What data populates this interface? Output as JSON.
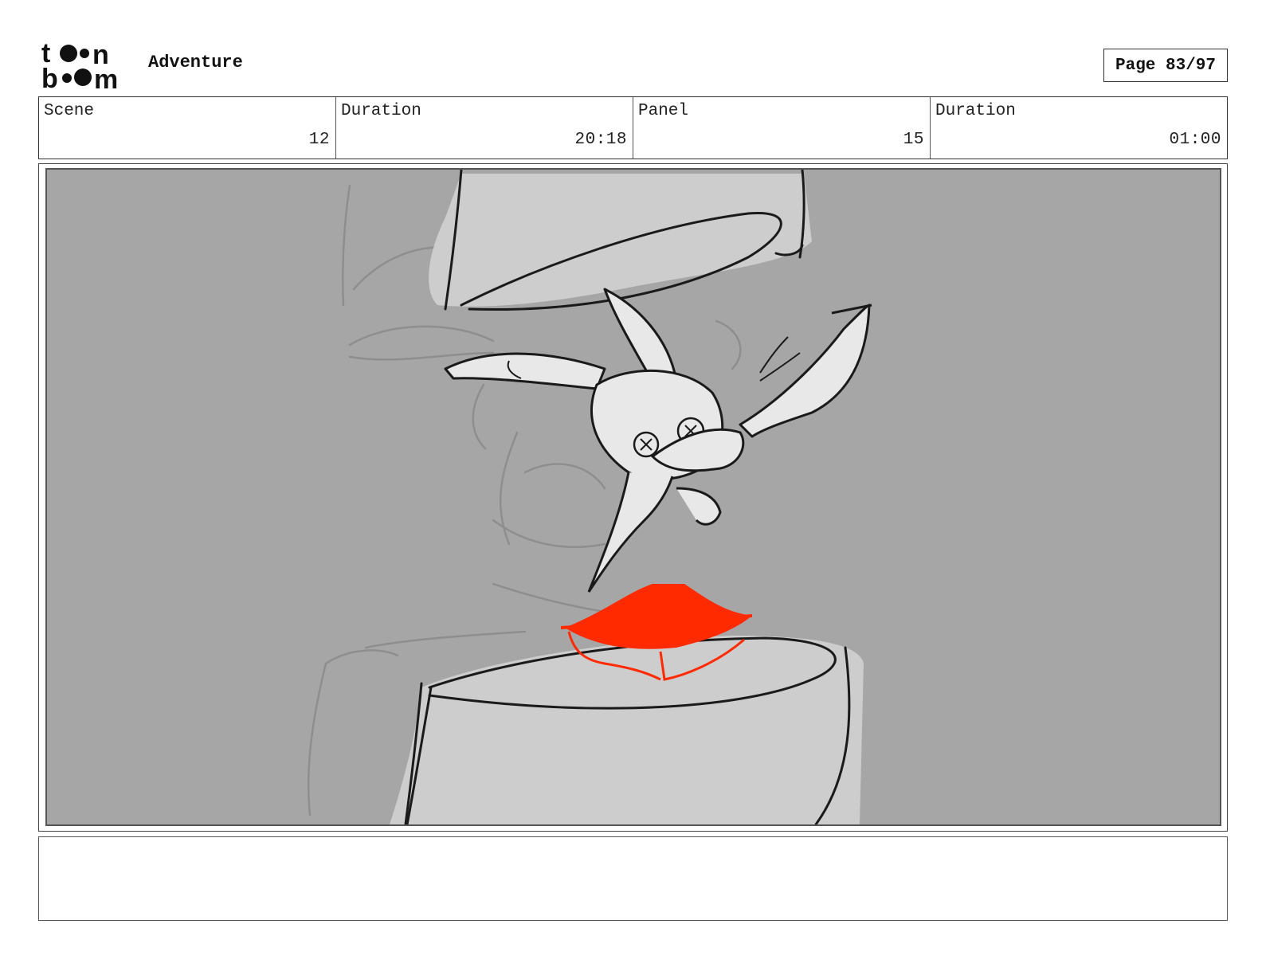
{
  "header": {
    "logo_name": "toonboom-logo",
    "logo_text": "toonboom",
    "project_title": "Adventure",
    "page_label": "Page 83/97"
  },
  "info": [
    {
      "label": "Scene",
      "value": "12"
    },
    {
      "label": "Duration",
      "value": "20:18"
    },
    {
      "label": "Panel",
      "value": "15"
    },
    {
      "label": "Duration",
      "value": "01:00"
    }
  ],
  "notes": {
    "text": ""
  },
  "colors": {
    "background_gray": "#a6a6a6",
    "light_gray": "#cdcdcd",
    "accent_red": "#ff2a00",
    "line_black": "#1a1a1a"
  }
}
